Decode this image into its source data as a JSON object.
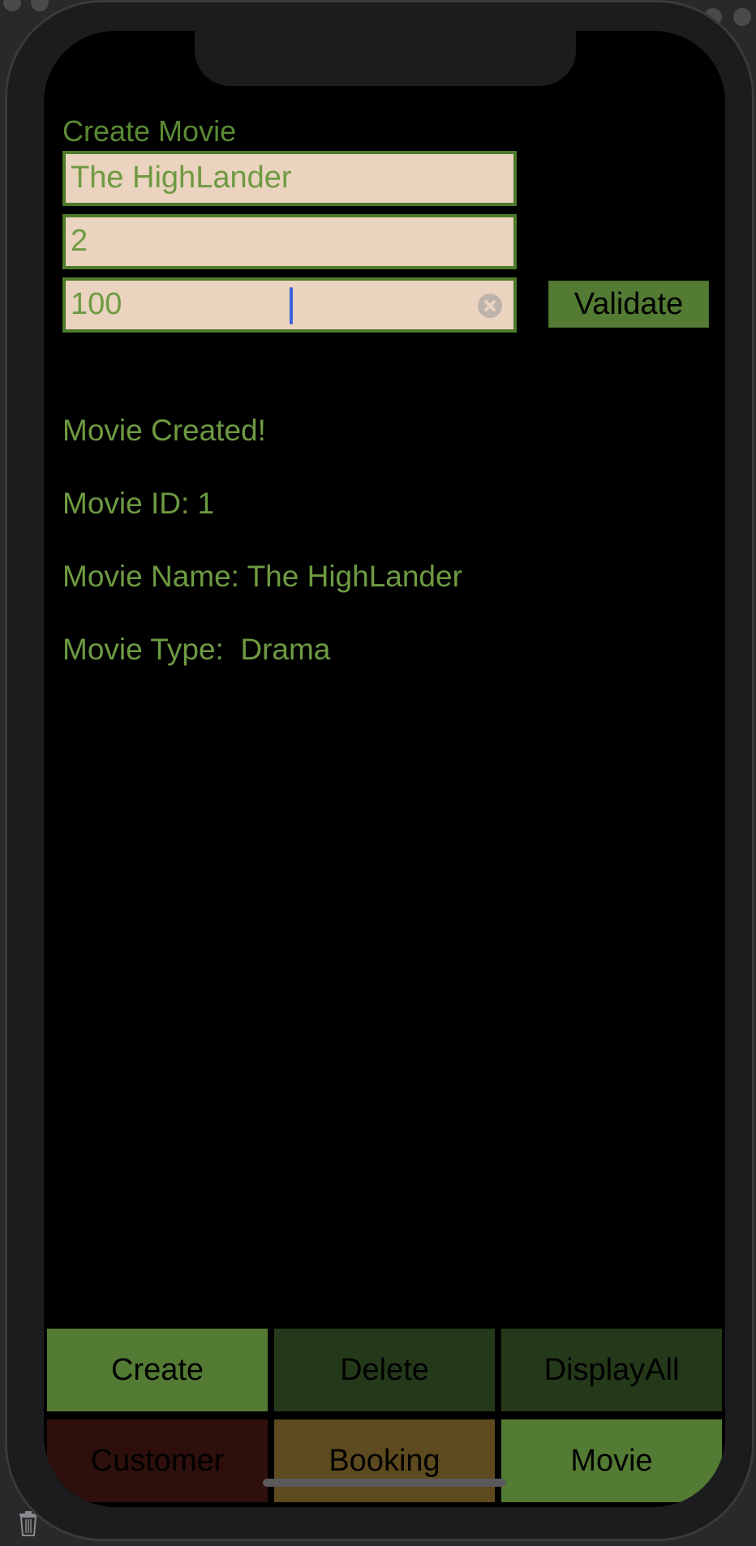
{
  "form": {
    "title": "Create Movie",
    "fields": [
      {
        "value": "The HighLander"
      },
      {
        "value": "2"
      },
      {
        "value": "100"
      }
    ],
    "validate_label": "Validate"
  },
  "result": {
    "status": "Movie Created!",
    "movie_id": "Movie ID: 1",
    "movie_name": "Movie Name: The HighLander",
    "movie_type": "Movie Type:  Drama"
  },
  "actions": {
    "create": "Create",
    "delete": "Delete",
    "display_all": "DisplayAll"
  },
  "tabs": {
    "customer": "Customer",
    "booking": "Booking",
    "movie": "Movie"
  },
  "colors": {
    "accent_green": "#537b34",
    "text_green": "#6e9a42",
    "field_bg": "#ead3bf",
    "customer_tab": "#2e0f0c",
    "booking_tab": "#5e4a1f",
    "inactive_action": "#24391a"
  }
}
